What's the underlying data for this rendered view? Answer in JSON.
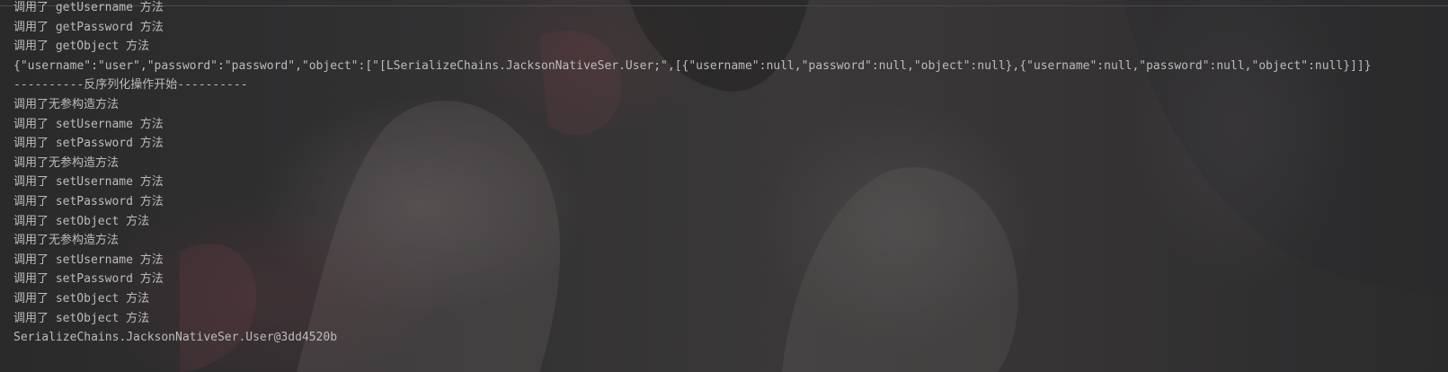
{
  "console": {
    "lines": [
      "调用了 getUsername 方法",
      "调用了 getPassword 方法",
      "调用了 getObject 方法",
      "{\"username\":\"user\",\"password\":\"password\",\"object\":[\"[LSerializeChains.JacksonNativeSer.User;\",[{\"username\":null,\"password\":null,\"object\":null},{\"username\":null,\"password\":null,\"object\":null}]]}",
      "----------反序列化操作开始----------",
      "调用了无参构造方法",
      "调用了 setUsername 方法",
      "调用了 setPassword 方法",
      "调用了无参构造方法",
      "调用了 setUsername 方法",
      "调用了 setPassword 方法",
      "调用了 setObject 方法",
      "调用了无参构造方法",
      "调用了 setUsername 方法",
      "调用了 setPassword 方法",
      "调用了 setObject 方法",
      "调用了 setObject 方法",
      "SerializeChains.JacksonNativeSer.User@3dd4520b"
    ],
    "text_color": "#bcbcbc",
    "background_color": "#2b2b2c"
  }
}
